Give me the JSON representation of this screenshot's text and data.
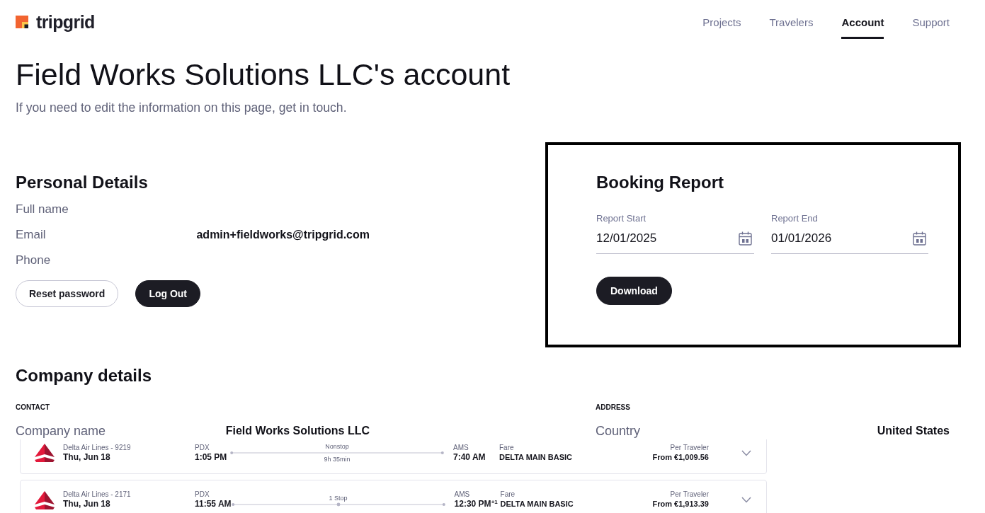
{
  "header": {
    "logo_text": "tripgrid",
    "nav": [
      {
        "label": "Projects",
        "selected": false
      },
      {
        "label": "Travelers",
        "selected": false
      },
      {
        "label": "Account",
        "selected": true
      },
      {
        "label": "Support",
        "selected": false
      }
    ]
  },
  "page": {
    "title": "Field Works Solutions LLC's account",
    "subtitle": "If you need to edit the information on this page, get in touch."
  },
  "personal_details": {
    "title": "Personal Details",
    "fields": [
      {
        "label": "Full name"
      },
      {
        "label": "Email",
        "value": "admin+fieldworks@tripgrid.com"
      },
      {
        "label": "Phone"
      }
    ],
    "buttons": [
      {
        "label": "Reset password",
        "kind": "outline"
      },
      {
        "label": "Log Out",
        "kind": "solid"
      }
    ]
  },
  "booking_report": {
    "title": "Booking Report",
    "fields": [
      {
        "label": "Report Start",
        "value": "12/01/2025"
      },
      {
        "label": "Report End",
        "value": "01/01/2026"
      }
    ],
    "button": "Download"
  },
  "company_details": {
    "title": "Company details",
    "sections": [
      {
        "heading": "CONTACT",
        "fields": [
          {
            "label": "Company name",
            "value": "Field Works Solutions LLC"
          }
        ]
      },
      {
        "heading": "ADDRESS",
        "fields": [
          {
            "label": "Country",
            "value": "United States"
          }
        ]
      }
    ]
  },
  "flights": [
    {
      "kind": "nonstop",
      "airline": "Delta Air Lines - 9219",
      "date": "Thu, Jun 18",
      "origin": "PDX",
      "departure": "1:05 PM",
      "stops": "Nonstop",
      "duration": "9h 35min",
      "destination": "AMS",
      "arrival": "7:40 AM",
      "fare_label": "Fare",
      "fare": "DELTA MAIN BASIC",
      "price_label": "Per Traveler",
      "price": "From €1,009.56"
    },
    {
      "kind": "one-stop",
      "airline": "Delta Air Lines - 2171",
      "date": "Thu, Jun 18",
      "origin": "PDX",
      "departure": "11:55 AM",
      "stops": "1 Stop",
      "destination": "AMS",
      "arrival": "12:30 PM$^{+1}$",
      "fare_label": "Fare",
      "fare": "DELTA MAIN BASIC",
      "price_label": "Per Traveler",
      "price": "From €1,913.39"
    }
  ]
}
